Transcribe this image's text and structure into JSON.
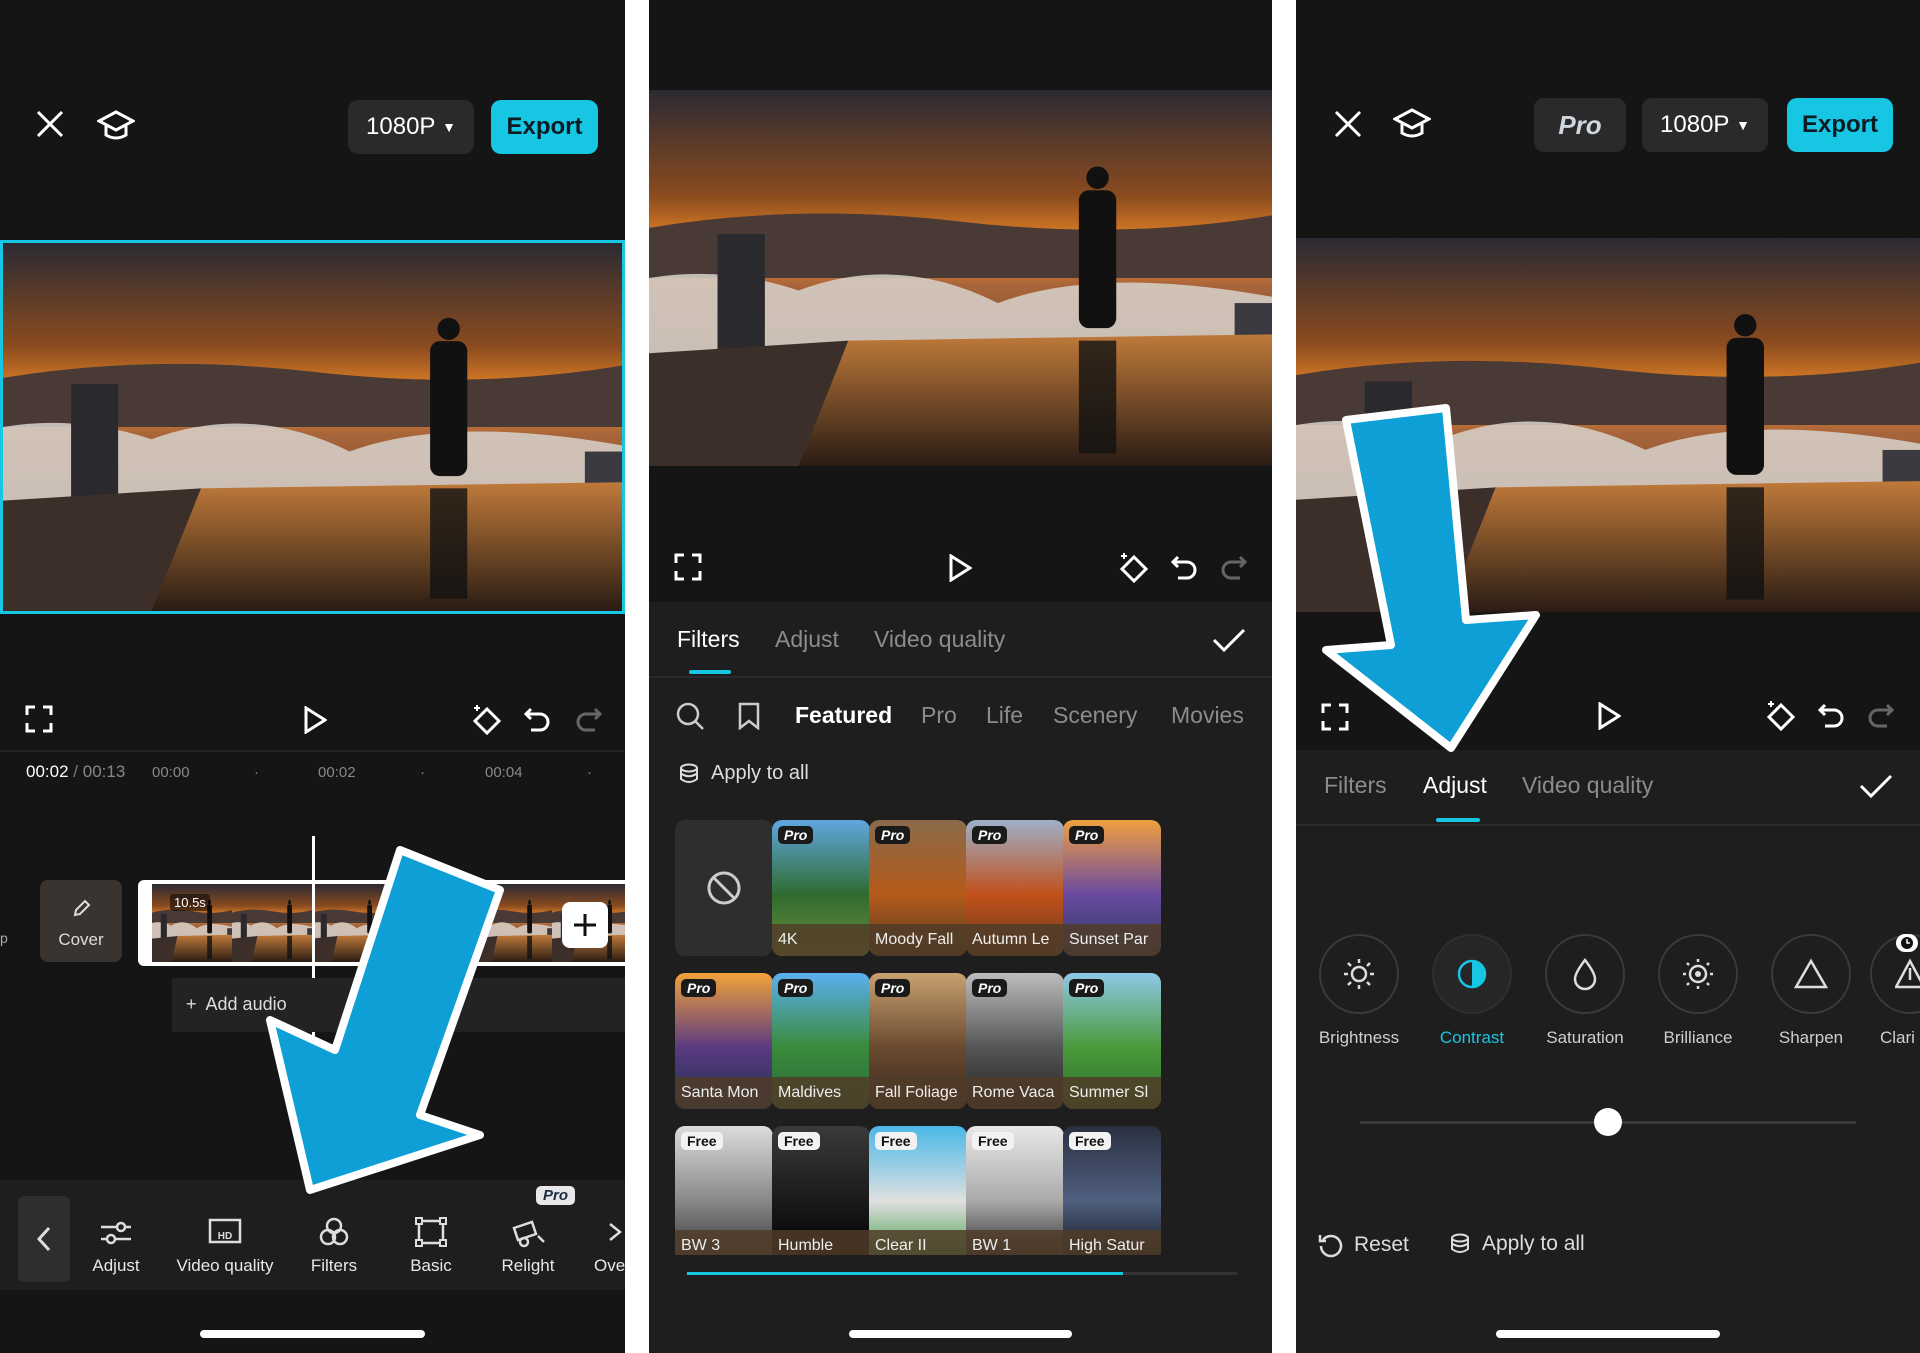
{
  "panel1": {
    "resolution": "1080P",
    "export_label": "Export",
    "time_current": "00:02",
    "time_sep": "/",
    "time_total": "00:13",
    "ticks": [
      "00:00",
      "00:02",
      "00:04"
    ],
    "clip_duration": "10.5s",
    "cover_label": "Cover",
    "add_audio_label": "Add audio",
    "pro_badge": "Pro",
    "tools": [
      {
        "label": "Adjust",
        "icon": "sliders-icon"
      },
      {
        "label": "Video quality",
        "icon": "hd-icon"
      },
      {
        "label": "Filters",
        "icon": "filters-icon"
      },
      {
        "label": "Basic",
        "icon": "crop-icon"
      },
      {
        "label": "Relight",
        "icon": "relight-icon"
      },
      {
        "label": "Ove",
        "icon": "overlay-icon"
      }
    ]
  },
  "panel2": {
    "tabs": [
      "Filters",
      "Adjust",
      "Video quality"
    ],
    "categories": [
      "Featured",
      "Pro",
      "Life",
      "Scenery",
      "Movies"
    ],
    "apply_all_label": "Apply to all",
    "filters": [
      {
        "label": "4K",
        "badge": "Pro"
      },
      {
        "label": "Moody Fall",
        "badge": "Pro"
      },
      {
        "label": "Autumn Le",
        "badge": "Pro"
      },
      {
        "label": "Sunset Par",
        "badge": "Pro"
      },
      {
        "label": "Santa Mon",
        "badge": "Pro"
      },
      {
        "label": "Maldives",
        "badge": "Pro"
      },
      {
        "label": "Fall Foliage",
        "badge": "Pro"
      },
      {
        "label": "Rome Vaca",
        "badge": "Pro"
      },
      {
        "label": "Summer Sl",
        "badge": "Pro"
      },
      {
        "label": "BW 3",
        "badge": "Free"
      },
      {
        "label": "Humble",
        "badge": "Free"
      },
      {
        "label": "Clear II",
        "badge": "Free"
      },
      {
        "label": "BW 1",
        "badge": "Free"
      },
      {
        "label": "High Satur",
        "badge": "Free"
      }
    ]
  },
  "panel3": {
    "pro_label": "Pro",
    "resolution": "1080P",
    "export_label": "Export",
    "tabs": [
      "Filters",
      "Adjust",
      "Video quality"
    ],
    "adjust_items": [
      "Brightness",
      "Contrast",
      "Saturation",
      "Brilliance",
      "Sharpen",
      "Clari"
    ],
    "reset_label": "Reset",
    "apply_all_label": "Apply to all",
    "slider_value": 0.5
  },
  "colors": {
    "accent": "#16c6e3",
    "arrow": "#0d9fd6"
  }
}
